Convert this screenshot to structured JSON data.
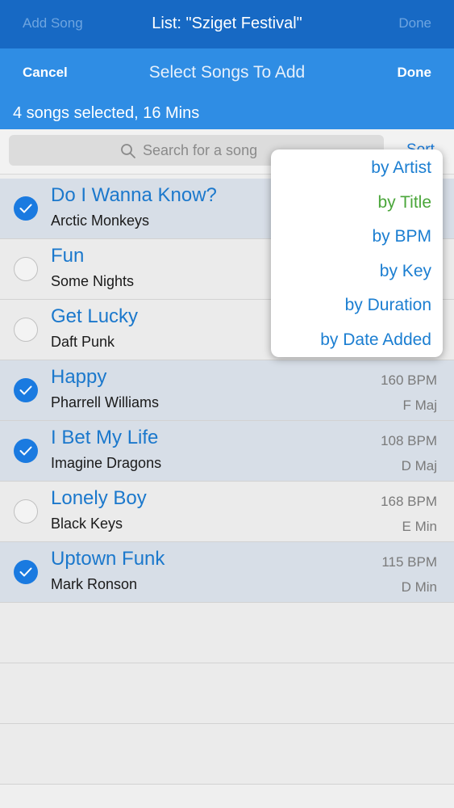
{
  "top_bar": {
    "left": "Add Song",
    "title": "List: \"Sziget Festival\"",
    "right": "Done"
  },
  "sheet": {
    "cancel": "Cancel",
    "title": "Select Songs To Add",
    "done": "Done",
    "status": "4 songs selected, 16 Mins"
  },
  "search": {
    "placeholder": "Search for a song",
    "sort_label": "Sort"
  },
  "songs": [
    {
      "title": "Do I Wanna Know?",
      "artist": "Arctic Monkeys",
      "bpm": "",
      "key": "",
      "selected": true
    },
    {
      "title": "Fun",
      "artist": "Some Nights",
      "bpm": "",
      "key": "",
      "selected": false
    },
    {
      "title": "Get Lucky",
      "artist": "Daft Punk",
      "bpm": "",
      "key": "",
      "selected": false
    },
    {
      "title": "Happy",
      "artist": "Pharrell Williams",
      "bpm": "160 BPM",
      "key": "F Maj",
      "selected": true
    },
    {
      "title": "I Bet My Life",
      "artist": "Imagine Dragons",
      "bpm": "108 BPM",
      "key": "D Maj",
      "selected": true
    },
    {
      "title": "Lonely Boy",
      "artist": "Black Keys",
      "bpm": "168 BPM",
      "key": "E Min",
      "selected": false
    },
    {
      "title": "Uptown Funk",
      "artist": "Mark Ronson",
      "bpm": "115 BPM",
      "key": "D Min",
      "selected": true
    }
  ],
  "sort_menu": {
    "options": [
      "by Artist",
      "by Title",
      "by BPM",
      "by Key",
      "by Duration",
      "by Date Added"
    ],
    "active": "by Title"
  },
  "colors": {
    "nav": "#1769c4",
    "header": "#2f8de4",
    "accent": "#1a7ae0",
    "active_option": "#4aa63a"
  }
}
